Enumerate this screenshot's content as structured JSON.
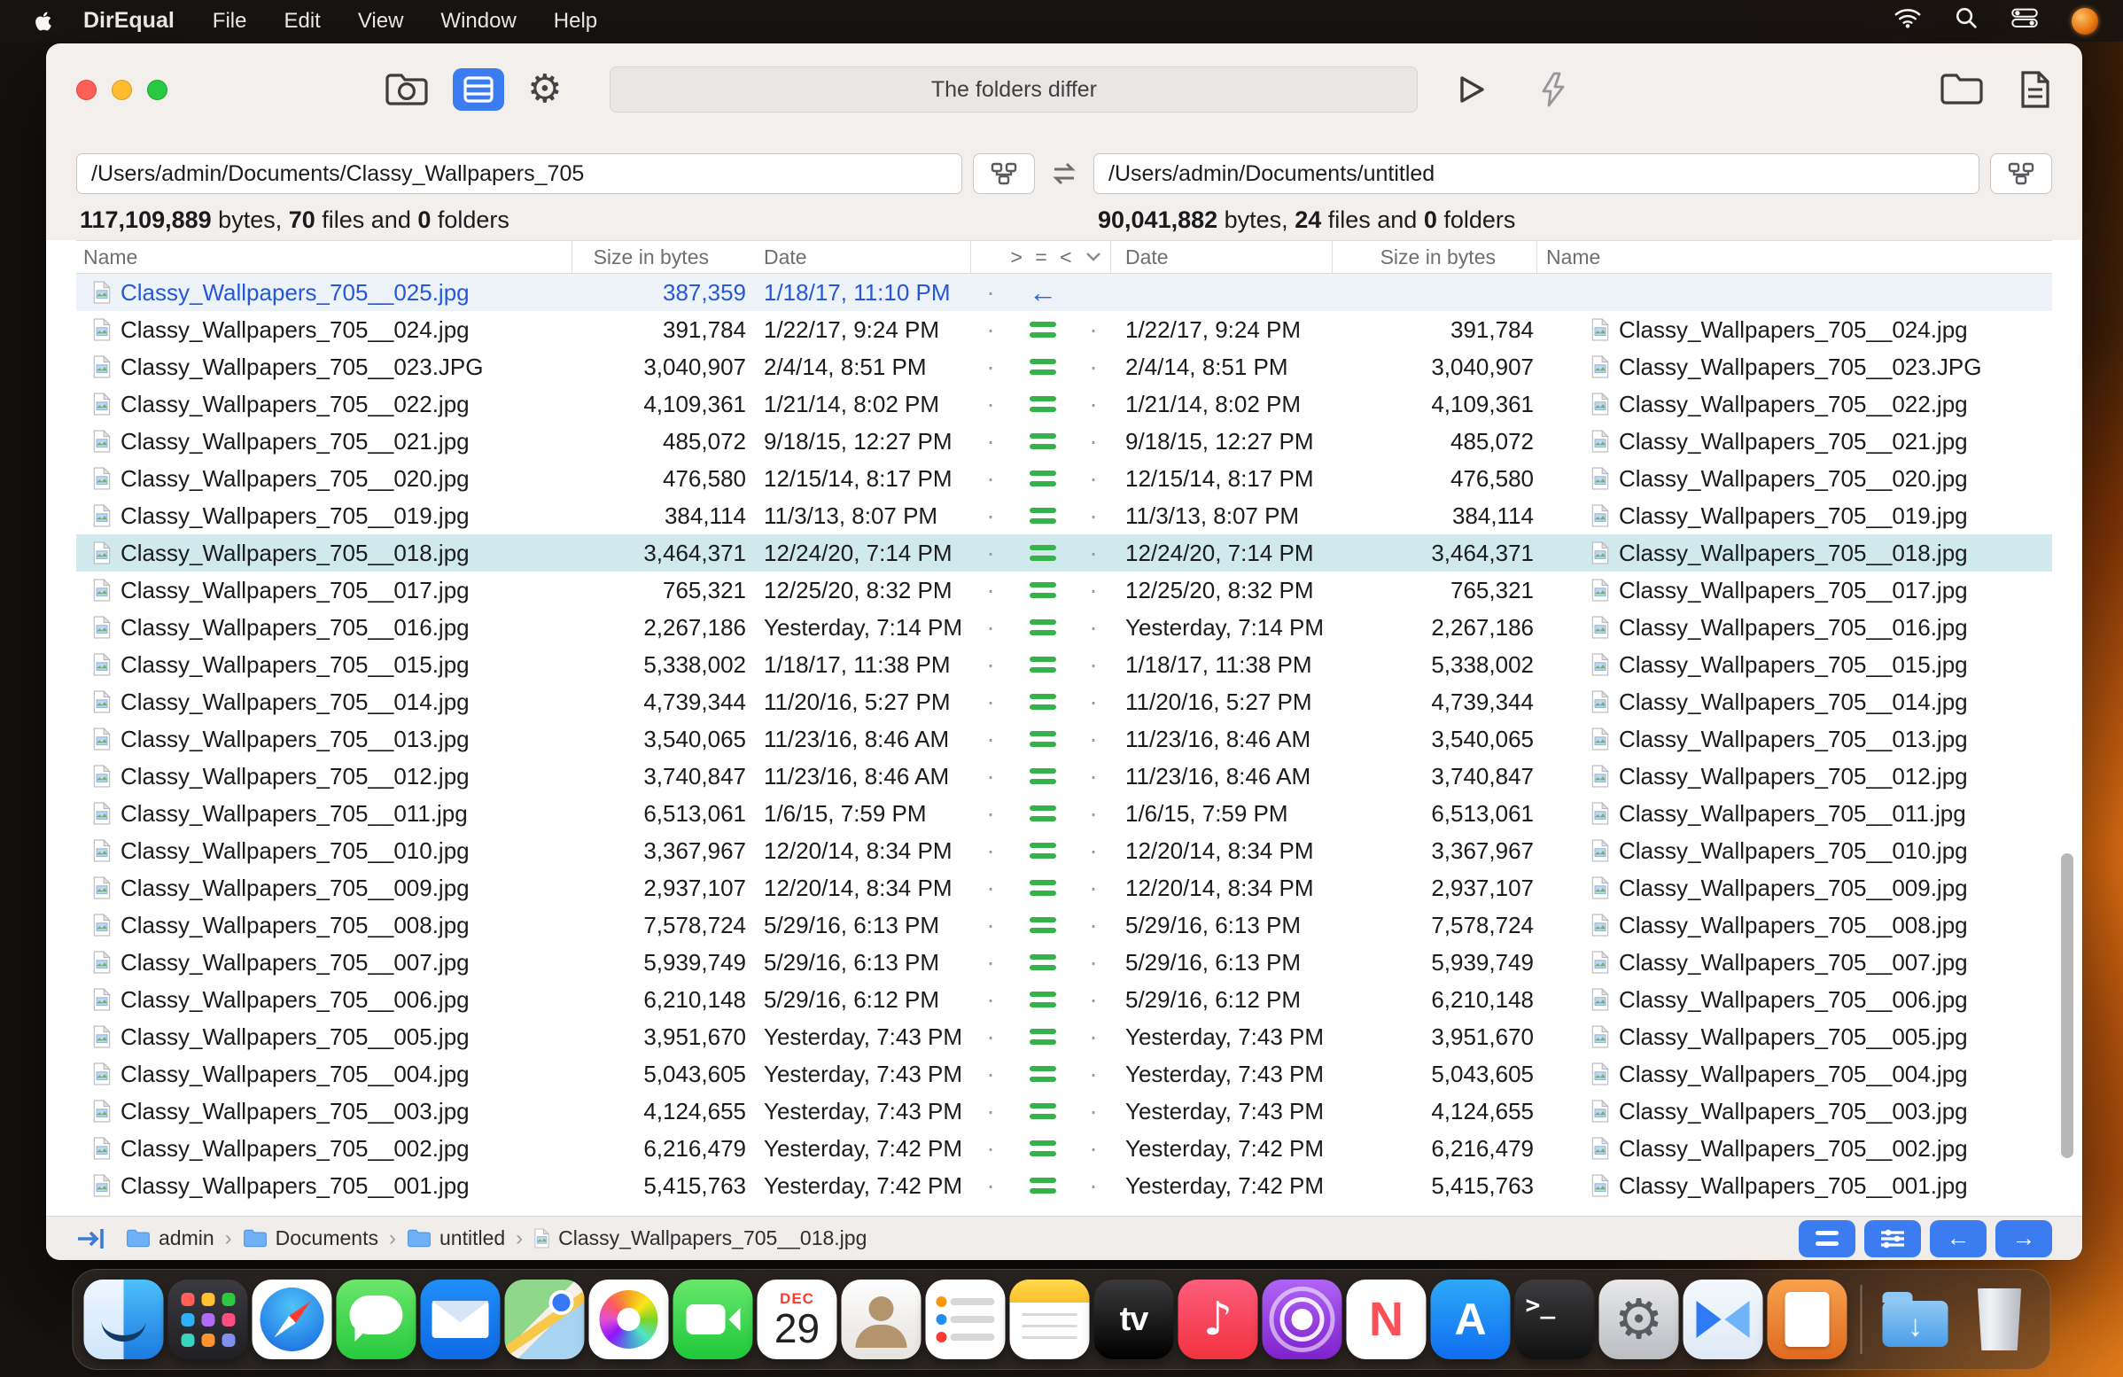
{
  "menu_bar": {
    "app_name": "DirEqual",
    "menus": [
      "File",
      "Edit",
      "View",
      "Window",
      "Help"
    ]
  },
  "toolbar": {
    "status_text": "The folders differ"
  },
  "left_pane": {
    "path": "/Users/admin/Documents/Classy_Wallpapers_705",
    "stats": {
      "bytes": "117,109,889",
      "bytes_label": " bytes, ",
      "files": "70",
      "files_label": " files and ",
      "folders": "0",
      "folders_label": " folders"
    }
  },
  "right_pane": {
    "path": "/Users/admin/Documents/untitled",
    "stats": {
      "bytes": "90,041,882",
      "bytes_label": " bytes, ",
      "files": "24",
      "files_label": " files and ",
      "folders": "0",
      "folders_label": " folders"
    }
  },
  "table": {
    "headers": {
      "name_left": "Name",
      "size_left": "Size in bytes",
      "date_left": "Date",
      "compare": "> = <",
      "date_right": "Date",
      "size_right": "Size in bytes",
      "name_right": "Name"
    },
    "rows": [
      {
        "name": "Classy_Wallpapers_705__025.jpg",
        "size": "387,359",
        "date": "1/18/17, 11:10 PM",
        "cmp": "left",
        "state": ""
      },
      {
        "name": "Classy_Wallpapers_705__024.jpg",
        "size": "391,784",
        "date": "1/22/17, 9:24 PM",
        "cmp": "eq",
        "state": ""
      },
      {
        "name": "Classy_Wallpapers_705__023.JPG",
        "size": "3,040,907",
        "date": "2/4/14, 8:51 PM",
        "cmp": "eq",
        "state": ""
      },
      {
        "name": "Classy_Wallpapers_705__022.jpg",
        "size": "4,109,361",
        "date": "1/21/14, 8:02 PM",
        "cmp": "eq",
        "state": ""
      },
      {
        "name": "Classy_Wallpapers_705__021.jpg",
        "size": "485,072",
        "date": "9/18/15, 12:27 PM",
        "cmp": "eq",
        "state": ""
      },
      {
        "name": "Classy_Wallpapers_705__020.jpg",
        "size": "476,580",
        "date": "12/15/14, 8:17 PM",
        "cmp": "eq",
        "state": ""
      },
      {
        "name": "Classy_Wallpapers_705__019.jpg",
        "size": "384,114",
        "date": "11/3/13, 8:07 PM",
        "cmp": "eq",
        "state": ""
      },
      {
        "name": "Classy_Wallpapers_705__018.jpg",
        "size": "3,464,371",
        "date": "12/24/20, 7:14 PM",
        "cmp": "eq",
        "state": "selected"
      },
      {
        "name": "Classy_Wallpapers_705__017.jpg",
        "size": "765,321",
        "date": "12/25/20, 8:32 PM",
        "cmp": "eq",
        "state": ""
      },
      {
        "name": "Classy_Wallpapers_705__016.jpg",
        "size": "2,267,186",
        "date": "Yesterday, 7:14 PM",
        "cmp": "eq",
        "state": ""
      },
      {
        "name": "Classy_Wallpapers_705__015.jpg",
        "size": "5,338,002",
        "date": "1/18/17, 11:38 PM",
        "cmp": "eq",
        "state": ""
      },
      {
        "name": "Classy_Wallpapers_705__014.jpg",
        "size": "4,739,344",
        "date": "11/20/16, 5:27 PM",
        "cmp": "eq",
        "state": ""
      },
      {
        "name": "Classy_Wallpapers_705__013.jpg",
        "size": "3,540,065",
        "date": "11/23/16, 8:46 AM",
        "cmp": "eq",
        "state": ""
      },
      {
        "name": "Classy_Wallpapers_705__012.jpg",
        "size": "3,740,847",
        "date": "11/23/16, 8:46 AM",
        "cmp": "eq",
        "state": ""
      },
      {
        "name": "Classy_Wallpapers_705__011.jpg",
        "size": "6,513,061",
        "date": "1/6/15, 7:59 PM",
        "cmp": "eq",
        "state": ""
      },
      {
        "name": "Classy_Wallpapers_705__010.jpg",
        "size": "3,367,967",
        "date": "12/20/14, 8:34 PM",
        "cmp": "eq",
        "state": ""
      },
      {
        "name": "Classy_Wallpapers_705__009.jpg",
        "size": "2,937,107",
        "date": "12/20/14, 8:34 PM",
        "cmp": "eq",
        "state": ""
      },
      {
        "name": "Classy_Wallpapers_705__008.jpg",
        "size": "7,578,724",
        "date": "5/29/16, 6:13 PM",
        "cmp": "eq",
        "state": ""
      },
      {
        "name": "Classy_Wallpapers_705__007.jpg",
        "size": "5,939,749",
        "date": "5/29/16, 6:13 PM",
        "cmp": "eq",
        "state": ""
      },
      {
        "name": "Classy_Wallpapers_705__006.jpg",
        "size": "6,210,148",
        "date": "5/29/16, 6:12 PM",
        "cmp": "eq",
        "state": ""
      },
      {
        "name": "Classy_Wallpapers_705__005.jpg",
        "size": "3,951,670",
        "date": "Yesterday, 7:43 PM",
        "cmp": "eq",
        "state": ""
      },
      {
        "name": "Classy_Wallpapers_705__004.jpg",
        "size": "5,043,605",
        "date": "Yesterday, 7:43 PM",
        "cmp": "eq",
        "state": ""
      },
      {
        "name": "Classy_Wallpapers_705__003.jpg",
        "size": "4,124,655",
        "date": "Yesterday, 7:43 PM",
        "cmp": "eq",
        "state": ""
      },
      {
        "name": "Classy_Wallpapers_705__002.jpg",
        "size": "6,216,479",
        "date": "Yesterday, 7:42 PM",
        "cmp": "eq",
        "state": ""
      },
      {
        "name": "Classy_Wallpapers_705__001.jpg",
        "size": "5,415,763",
        "date": "Yesterday, 7:42 PM",
        "cmp": "eq",
        "state": ""
      }
    ]
  },
  "status_bar": {
    "crumbs": [
      {
        "label": "admin",
        "type": "folder"
      },
      {
        "label": "Documents",
        "type": "folder"
      },
      {
        "label": "untitled",
        "type": "folder"
      },
      {
        "label": "Classy_Wallpapers_705__018.jpg",
        "type": "file"
      }
    ]
  },
  "dock": {
    "calendar": {
      "month": "DEC",
      "day": "29"
    },
    "items": [
      "finder",
      "launchpad",
      "safari",
      "messages",
      "mail",
      "maps",
      "photos",
      "facetime",
      "calendar",
      "contacts",
      "reminders",
      "notes",
      "tv",
      "music",
      "podcasts",
      "news",
      "app-store",
      "terminal",
      "system-preferences",
      "direqual",
      "books",
      "divider",
      "downloads",
      "trash"
    ]
  }
}
